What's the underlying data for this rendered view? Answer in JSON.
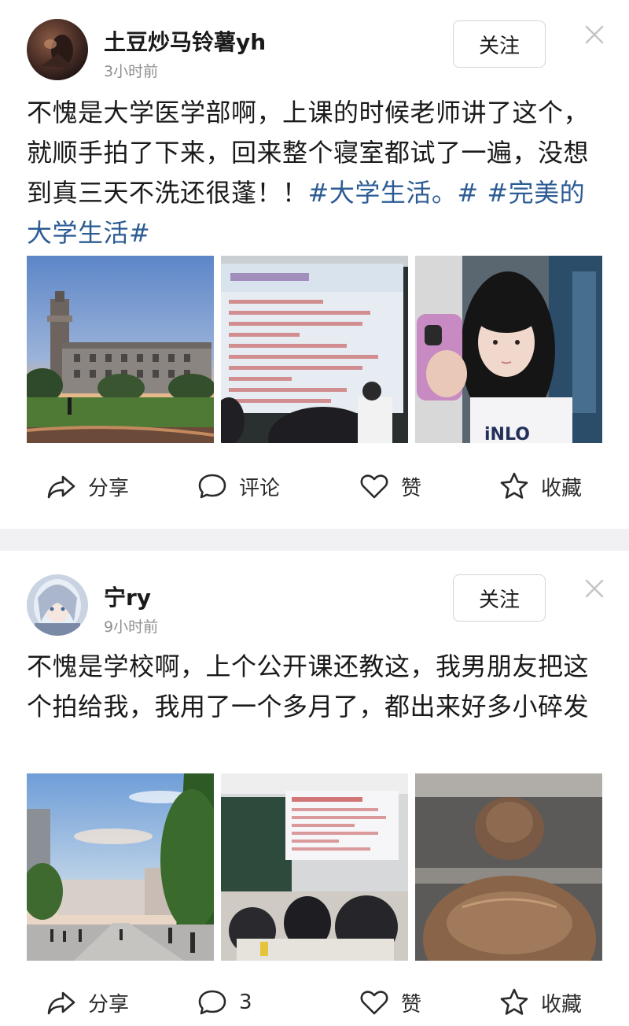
{
  "posts": [
    {
      "username": "土豆炒马铃薯yh",
      "time": "3小时前",
      "follow_label": "关注",
      "text_plain": "不愧是大学医学部啊，上课的时候老师讲了这个，就顺手拍了下来，回来整个寝室都试了一遍，没想到真三天不洗还很蓬！！",
      "hashtag_1": "#大学生活。#",
      "hashtag_2": "#完美的大学生活#",
      "images": [
        "campus-building-photo",
        "lecture-slide-photo",
        "girl-selfie-photo"
      ],
      "actions": {
        "share": "分享",
        "comment": "评论",
        "like": "赞",
        "favorite": "收藏"
      }
    },
    {
      "username": "宁ry",
      "time": "9小时前",
      "follow_label": "关注",
      "text_plain": "不愧是学校啊，上个公开课还教这，我男朋友把这个拍给我，我用了一个多月了，都出来好多小碎发",
      "images": [
        "campus-road-photo",
        "classroom-slide-photo",
        "hair-bun-photo"
      ],
      "actions": {
        "share": "分享",
        "comment": "3",
        "like": "赞",
        "favorite": "收藏"
      }
    }
  ],
  "colors": {
    "hashtag": "#2c5c94",
    "text": "#1a1a1a",
    "time": "#8f8f8f",
    "divider": "#f1f1f3"
  }
}
